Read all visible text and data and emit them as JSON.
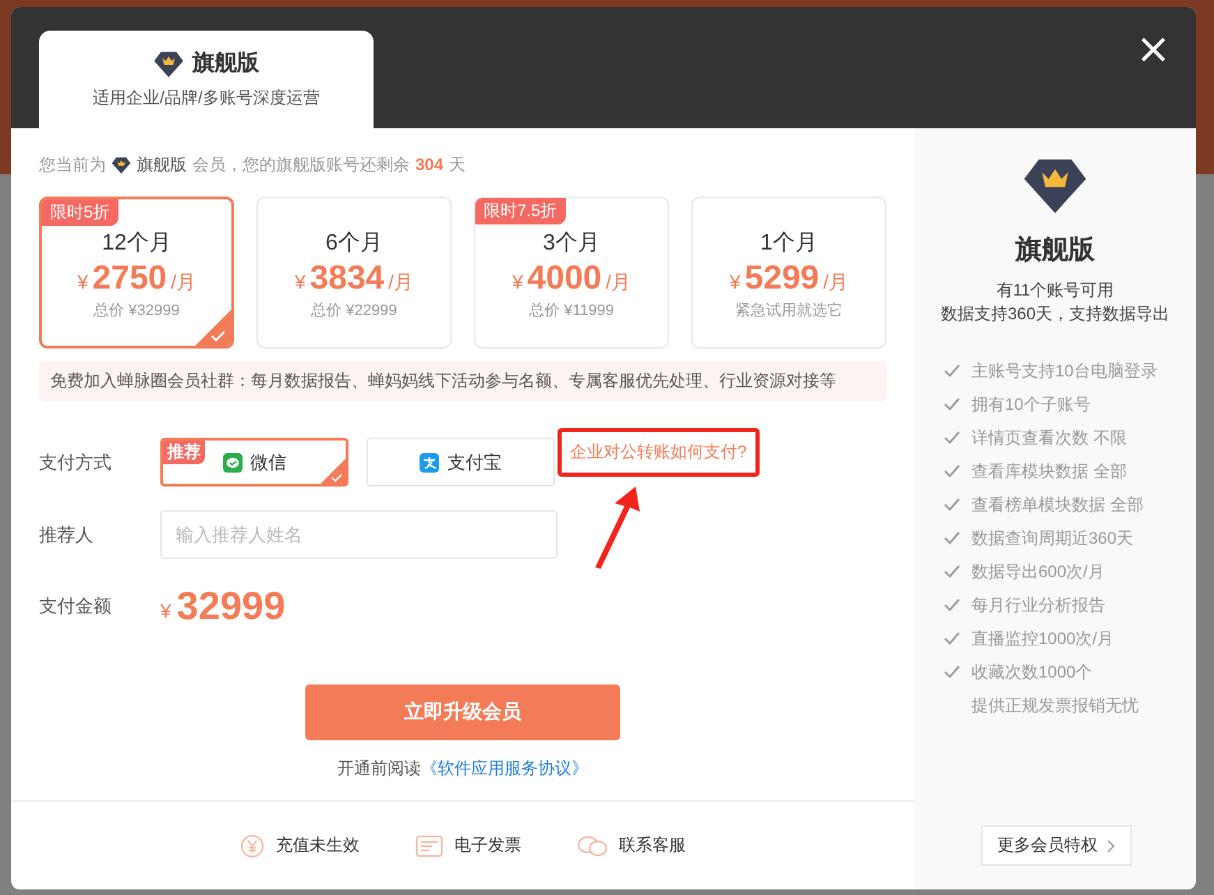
{
  "close_label": "×",
  "tab": {
    "title": "旗舰版",
    "subtitle": "适用企业/品牌/多账号深度运营"
  },
  "membership_notice": {
    "prefix": "您当前为",
    "level": "旗舰版",
    "middle": "会员，您的旗舰版账号还剩余",
    "days": "304",
    "suffix": "天"
  },
  "plans": [
    {
      "duration": "12个月",
      "currency": "¥",
      "price": "2750",
      "unit": "/月",
      "note": "总价 ¥32999",
      "badge": "限时5折",
      "selected": true
    },
    {
      "duration": "6个月",
      "currency": "¥",
      "price": "3834",
      "unit": "/月",
      "note": "总价 ¥22999",
      "selected": false
    },
    {
      "duration": "3个月",
      "currency": "¥",
      "price": "4000",
      "unit": "/月",
      "note": "总价 ¥11999",
      "badge": "限时7.5折",
      "selected": false
    },
    {
      "duration": "1个月",
      "currency": "¥",
      "price": "5299",
      "unit": "/月",
      "note": "紧急试用就选它",
      "selected": false
    }
  ],
  "benefit_banner": "免费加入蝉脉圈会员社群：每月数据报告、蝉妈妈线下活动参与名额、专属客服优先处理、行业资源对接等",
  "payment": {
    "label": "支付方式",
    "methods": [
      {
        "kind": "wechat",
        "label": "微信",
        "badge": "推荐",
        "selected": true
      },
      {
        "kind": "alipay",
        "label": "支付宝",
        "selected": false
      }
    ],
    "transfer_link": "企业对公转账如何支付?"
  },
  "referrer": {
    "label": "推荐人",
    "placeholder": "输入推荐人姓名"
  },
  "amount": {
    "label": "支付金额",
    "currency": "¥",
    "value": "32999"
  },
  "submit_button": "立即升级会员",
  "agreement": {
    "text": "开通前阅读",
    "link": "《软件应用服务协议》"
  },
  "footer_links": [
    {
      "kind": "recharge",
      "label": "充值未生效"
    },
    {
      "kind": "invoice",
      "label": "电子发票"
    },
    {
      "kind": "service",
      "label": "联系客服"
    }
  ],
  "side_panel": {
    "title": "旗舰版",
    "lines": [
      "有11个账号可用",
      "数据支持360天，支持数据导出"
    ],
    "features": [
      {
        "label": "主账号支持10台电脑登录",
        "checked": true
      },
      {
        "label": "拥有10个子账号",
        "checked": true
      },
      {
        "label": "详情页查看次数 不限",
        "checked": true
      },
      {
        "label": "查看库模块数据 全部",
        "checked": true
      },
      {
        "label": "查看榜单模块数据 全部",
        "checked": true
      },
      {
        "label": "数据查询周期近360天",
        "checked": true
      },
      {
        "label": "数据导出600次/月",
        "checked": true
      },
      {
        "label": "每月行业分析报告",
        "checked": true
      },
      {
        "label": "直播监控1000次/月",
        "checked": true
      },
      {
        "label": "收藏次数1000个",
        "checked": true
      },
      {
        "label": "提供正规发票报销无忧",
        "checked": false
      }
    ],
    "more_button": "更多会员特权"
  }
}
